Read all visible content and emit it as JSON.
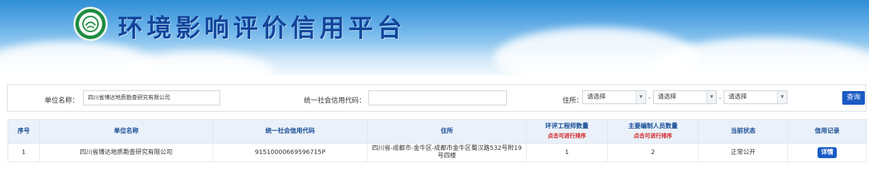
{
  "header": {
    "title": "环境影响评价信用平台",
    "logo_label": "MEE"
  },
  "search": {
    "unit_name_label": "单位名称：",
    "unit_name_value": "四川省博达地质勘查研究有限公司",
    "credit_code_label": "统一社会信用代码：",
    "credit_code_value": "",
    "address_label": "住所：",
    "province_select": "请选择",
    "city_select": "请选择",
    "district_select": "请选择",
    "separator": "-",
    "query_button": "查询"
  },
  "table": {
    "headers": {
      "index": "序号",
      "unit_name": "单位名称",
      "credit_code": "统一社会信用代码",
      "address": "住所",
      "engineer_count": "环评工程师数量",
      "engineer_sort": "点击可进行排序",
      "staff_count": "主要编制人员数量",
      "staff_sort": "点击可进行排序",
      "status": "当前状态",
      "record": "信用记录"
    },
    "rows": [
      {
        "index": "1",
        "unit_name": "四川省博达地质勘查研究有限公司",
        "credit_code": "91510000669596715P",
        "address": "四川省-成都市-金牛区-成都市金牛区蜀汉路532号附19号四楼",
        "engineer_count": "1",
        "staff_count": "2",
        "status": "正常公开",
        "record_button": "详情"
      }
    ]
  },
  "colors": {
    "accent": "#1a5bc4",
    "title": "#12459a",
    "sort_hint": "#d31f1f",
    "header_bg": "#eaf1fa"
  }
}
